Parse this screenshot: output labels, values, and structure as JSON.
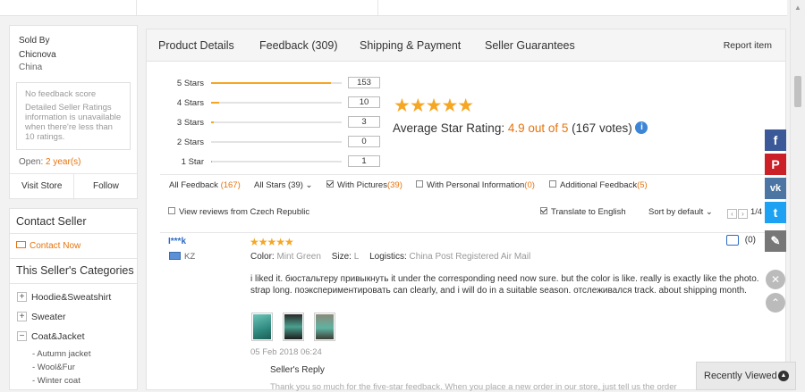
{
  "seller": {
    "sold_by_label": "Sold By",
    "name": "Chicnova",
    "country": "China",
    "no_feedback": "No feedback score",
    "feedback_note": "Detailed Seller Ratings information is unavailable when there're less than 10 ratings.",
    "open_label": "Open:",
    "open_value": "2 year(s)",
    "visit_store": "Visit Store",
    "follow": "Follow"
  },
  "contact": {
    "title": "Contact Seller",
    "contact_now": "Contact Now",
    "categories_title": "This Seller's Categories",
    "categories": [
      {
        "sign": "+",
        "label": "Hoodie&Sweatshirt"
      },
      {
        "sign": "+",
        "label": "Sweater"
      },
      {
        "sign": "−",
        "label": "Coat&Jacket"
      }
    ],
    "subcategories": [
      "- Autumn jacket",
      "- Wool&Fur",
      "- Winter coat"
    ]
  },
  "tabs": [
    {
      "label": "Product Details"
    },
    {
      "label": "Feedback (309)"
    },
    {
      "label": "Shipping & Payment"
    },
    {
      "label": "Seller Guarantees"
    }
  ],
  "report_item": "Report item",
  "ratings": [
    {
      "label": "5 Stars",
      "count": "153",
      "fraction": 0.92
    },
    {
      "label": "4 Stars",
      "count": "10",
      "fraction": 0.06
    },
    {
      "label": "3 Stars",
      "count": "3",
      "fraction": 0.018
    },
    {
      "label": "2 Stars",
      "count": "0",
      "fraction": 0
    },
    {
      "label": "1 Star",
      "count": "1",
      "fraction": 0.006
    }
  ],
  "big_stars": "★★★★★",
  "average": {
    "label": "Average Star Rating:",
    "value": "4.9 out of 5",
    "votes": "(167 votes)",
    "info": "i"
  },
  "filters": {
    "all_feedback": "All Feedback",
    "all_feedback_count": "(167)",
    "all_stars": "All Stars (39)",
    "with_pictures": "With Pictures",
    "with_pictures_count": "(39)",
    "personal_info": "With Personal Information",
    "personal_info_count": "(0)",
    "additional": "Additional Feedback",
    "additional_count": "(5)",
    "view_country": "View reviews from Czech Republic",
    "translate": "Translate to English",
    "sort": "Sort by default",
    "page": "1/4"
  },
  "review": {
    "user": "I***k",
    "country": "KZ",
    "stars": "★★★★★",
    "color_label": "Color:",
    "color_value": "Mint Green",
    "size_label": "Size:",
    "size_value": "L",
    "logistics_label": "Logistics:",
    "logistics_value": "China Post Registered Air Mail",
    "text": "i liked it. бюстальтеру привыкнуть it under the corresponding need now sure. but the color is like. really is exactly like the photo. strap long. поэкспериментировать can clearly, and i will do in a suitable season. отслеживался track. about shipping month.",
    "date": "05 Feb 2018 06:24",
    "reply_label": "Seller's Reply",
    "reply_text": "Thank you so much for the five-star feedback. When you place a new order in our store, just tell us the order",
    "likes": "(0)"
  },
  "recently_viewed": "Recently Viewed",
  "colors": {
    "accent": "#e6740e",
    "star": "#f5a623",
    "link": "#2e6bc6",
    "facebook": "#3b5998",
    "pinterest": "#cb2027",
    "vk": "#4c75a3",
    "twitter": "#1da1f2",
    "edit": "#777777"
  }
}
